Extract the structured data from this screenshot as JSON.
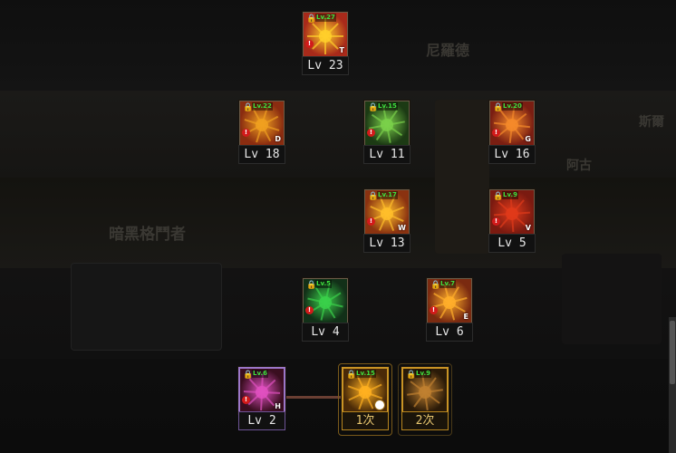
{
  "background_text": {
    "t1": "尼羅德",
    "t2": "暗黑格鬥者",
    "t3": "阿古",
    "t4": "斯爾"
  },
  "skills": [
    {
      "id": "s23",
      "lock": "🔒",
      "lvreq": "Lv.27",
      "letter": "T",
      "label": "Lv 23",
      "colors": [
        "#a82a1a",
        "#ffcf2a"
      ]
    },
    {
      "id": "s18",
      "lock": "🔒",
      "lvreq": "Lv.22",
      "letter": "D",
      "label": "Lv 18",
      "colors": [
        "#8a2c10",
        "#f0a020"
      ]
    },
    {
      "id": "s11",
      "lock": "🔒",
      "lvreq": "Lv.15",
      "letter": "",
      "label": "Lv 11",
      "colors": [
        "#1c3a14",
        "#7ad04a"
      ]
    },
    {
      "id": "s16",
      "lock": "🔒",
      "lvreq": "Lv.20",
      "letter": "G",
      "label": "Lv 16",
      "colors": [
        "#7a1e12",
        "#f58a2a"
      ]
    },
    {
      "id": "s13",
      "lock": "🔒",
      "lvreq": "Lv.17",
      "letter": "W",
      "label": "Lv 13",
      "colors": [
        "#8a3210",
        "#ffbe2a"
      ]
    },
    {
      "id": "s5",
      "lock": "🔒",
      "lvreq": "Lv.9",
      "letter": "V",
      "label": "Lv 5",
      "colors": [
        "#7a1a10",
        "#e03a1a"
      ]
    },
    {
      "id": "s4",
      "lock": "🔒",
      "lvreq": "Lv.5",
      "letter": "",
      "label": "Lv 4",
      "colors": [
        "#123018",
        "#3ad04a"
      ]
    },
    {
      "id": "s6",
      "lock": "🔒",
      "lvreq": "Lv.7",
      "letter": "E",
      "label": "Lv 6",
      "colors": [
        "#7a2a10",
        "#ffae2a"
      ]
    },
    {
      "id": "s2",
      "lock": "🔒",
      "lvreq": "Lv.6",
      "letter": "H",
      "label": "Lv 2",
      "colors": [
        "#3a0e20",
        "#e050c0"
      ]
    },
    {
      "id": "c1",
      "lock": "🔒",
      "lvreq": "Lv.15",
      "letter": "",
      "label": "1次",
      "colors": [
        "#4a2a08",
        "#ffb020"
      ]
    },
    {
      "id": "c2",
      "lock": "🔒",
      "lvreq": "Lv.9",
      "letter": "",
      "label": "2次",
      "colors": [
        "#2a1a08",
        "#c08030"
      ]
    }
  ],
  "warn_symbol": "!",
  "icon_names": {
    "lock": "lock-icon",
    "warn": "warning-icon",
    "clock": "cooldown-clock-icon"
  }
}
